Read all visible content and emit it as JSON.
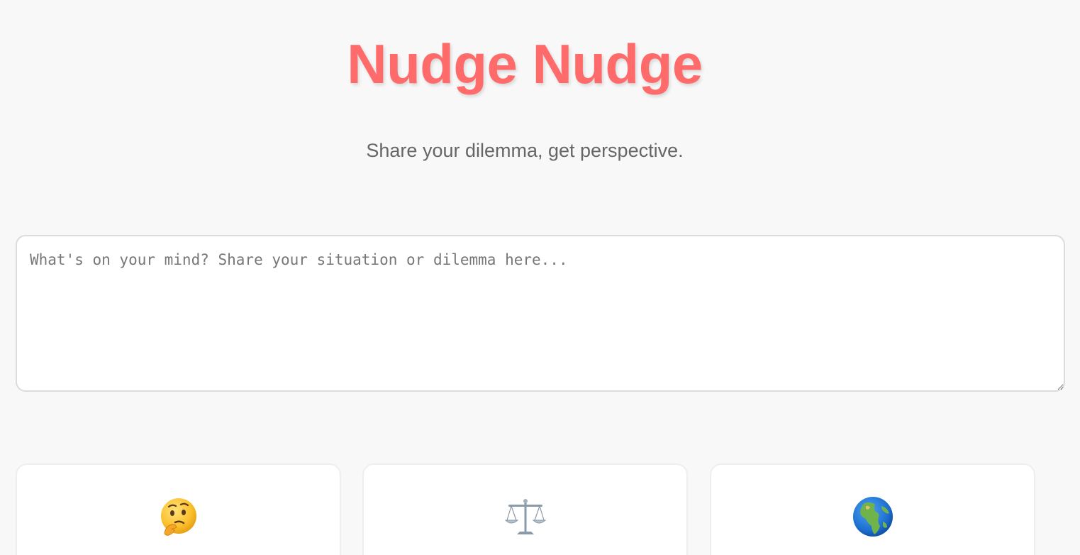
{
  "header": {
    "title": "Nudge Nudge",
    "subtitle": "Share your dilemma, get perspective."
  },
  "dilemma_input": {
    "placeholder": "What's on your mind? Share your situation or dilemma here...",
    "value": ""
  },
  "cards": [
    {
      "icon": "thinking-face-icon",
      "glyph": "🤔"
    },
    {
      "icon": "balance-scale-icon",
      "glyph": "⚖️"
    },
    {
      "icon": "globe-icon",
      "glyph": "🌍"
    }
  ],
  "colors": {
    "title": "#ff6b6b",
    "subtitle": "#666666",
    "background": "#f8f8f8"
  }
}
